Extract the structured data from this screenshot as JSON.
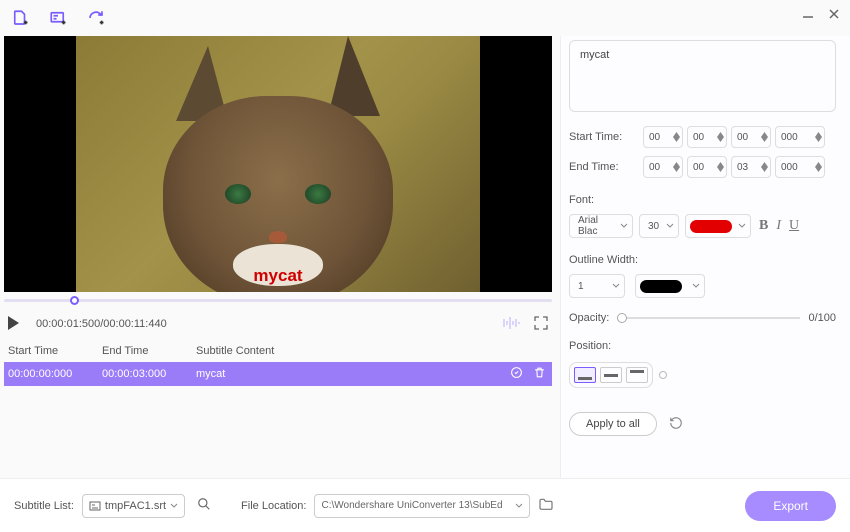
{
  "subtitle": {
    "text": "mycat",
    "overlay": "mycat"
  },
  "timing": {
    "start_label": "Start Time:",
    "end_label": "End Time:",
    "start": {
      "h": "00",
      "m": "00",
      "s": "00",
      "ms": "000"
    },
    "end": {
      "h": "00",
      "m": "00",
      "s": "03",
      "ms": "000"
    }
  },
  "font": {
    "label": "Font:",
    "name": "Arial Blac",
    "size": "30",
    "color": "#e30000",
    "bold": "B",
    "italic": "I",
    "underline": "U"
  },
  "outline": {
    "label": "Outline Width:",
    "width": "1",
    "color": "#000000"
  },
  "opacity": {
    "label": "Opacity:",
    "readout": "0/100"
  },
  "position": {
    "label": "Position:"
  },
  "apply_label": "Apply to all",
  "player": {
    "time": "00:00:01:500/00:00:11:440"
  },
  "table": {
    "headers": {
      "start": "Start Time",
      "end": "End Time",
      "content": "Subtitle Content"
    },
    "row": {
      "start": "00:00:00:000",
      "end": "00:00:03:000",
      "content": "mycat"
    }
  },
  "footer": {
    "sub_label": "Subtitle List:",
    "sub_file": "tmpFAC1.srt",
    "loc_label": "File Location:",
    "loc_path": "C:\\Wondershare UniConverter 13\\SubEd",
    "export": "Export"
  }
}
